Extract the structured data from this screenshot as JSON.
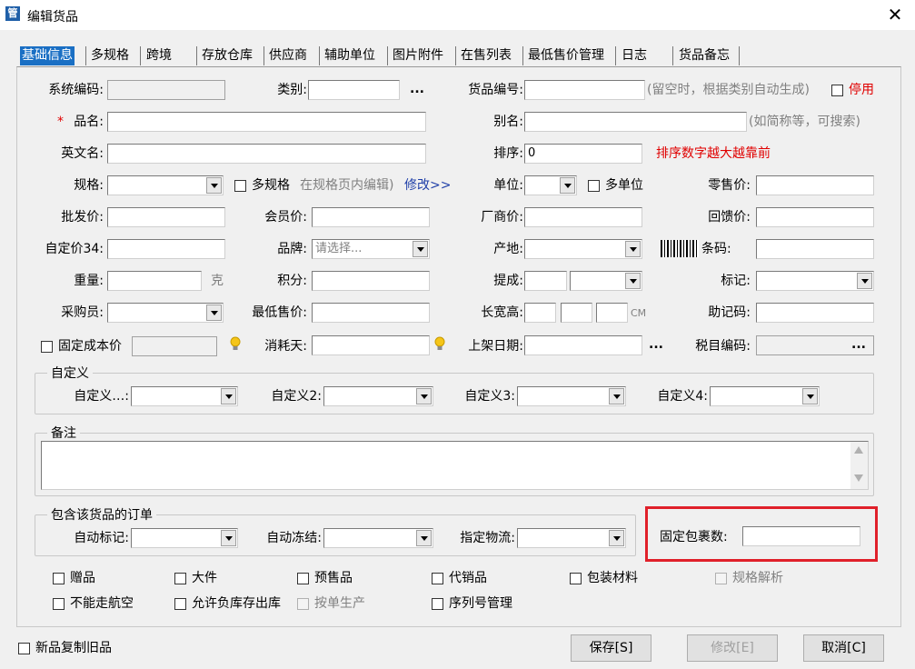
{
  "window": {
    "title": "编辑货品",
    "close": "✕"
  },
  "tabs": [
    "基础信息",
    "多规格",
    "跨境",
    "存放仓库",
    "供应商",
    "辅助单位",
    "图片附件",
    "在售列表",
    "最低售价管理",
    "日志",
    "货品备忘"
  ],
  "fields": {
    "system_code": "系统编码:",
    "category": "类别:",
    "more": "...",
    "goods_code": "货品编号:",
    "goods_code_hint": "(留空时，根据类别自动生成)",
    "disable": "停用",
    "name_star": "*",
    "name": "品名:",
    "alias": "别名:",
    "alias_hint": "(如简称等，可搜索)",
    "english_name": "英文名:",
    "sort": "排序:",
    "sort_value": "0",
    "sort_hint": "排序数字越大越靠前",
    "spec": "规格:",
    "multi_spec": "多规格",
    "multi_spec_hint": "在规格页内编辑)",
    "modify_link": "修改>>",
    "unit": "单位:",
    "multi_unit": "多单位",
    "retail_price": "零售价:",
    "wholesale_price": "批发价:",
    "member_price": "会员价:",
    "vendor_price": "厂商价:",
    "return_price": "回馈价:",
    "custom_price": "自定价34:",
    "brand": "品牌:",
    "brand_placeholder": "请选择...",
    "origin": "产地:",
    "barcode": "条码:",
    "weight": "重量:",
    "weight_unit": "克",
    "points": "积分:",
    "commission": "提成:",
    "mark": "标记:",
    "buyer": "采购员:",
    "min_price": "最低售价:",
    "dimensions": "长宽高:",
    "dimensions_unit": "CM",
    "mnemonic": "助记码:",
    "fixed_cost": "固定成本价",
    "consume_days": "消耗天:",
    "shelf_date": "上架日期:",
    "tax_code": "税目编码:"
  },
  "custom_group": {
    "title": "自定义",
    "labels": [
      "自定义…:",
      "自定义2:",
      "自定义3:",
      "自定义4:"
    ]
  },
  "remark_group": {
    "title": "备注"
  },
  "orders_group": {
    "title": "包含该货品的订单",
    "auto_mark": "自动标记:",
    "auto_freeze": "自动冻结:",
    "logistics": "指定物流:"
  },
  "fixed_parcels": "固定包裹数:",
  "checkboxes": {
    "gift": "赠品",
    "large": "大件",
    "presale": "预售品",
    "consign": "代销品",
    "packaging": "包装材料",
    "spec_parse": "规格解析",
    "no_air": "不能走航空",
    "allow_negative": "允许负库存出库",
    "make_to_order": "按单生产",
    "serial": "序列号管理"
  },
  "footer": {
    "copy_old": "新品复制旧品",
    "save": "保存[S]",
    "modify": "修改[E]",
    "cancel": "取消[C]"
  },
  "colors": {
    "accent": "#1a6fc4",
    "highlight": "#e0202a",
    "hint_red": "#e00000"
  }
}
